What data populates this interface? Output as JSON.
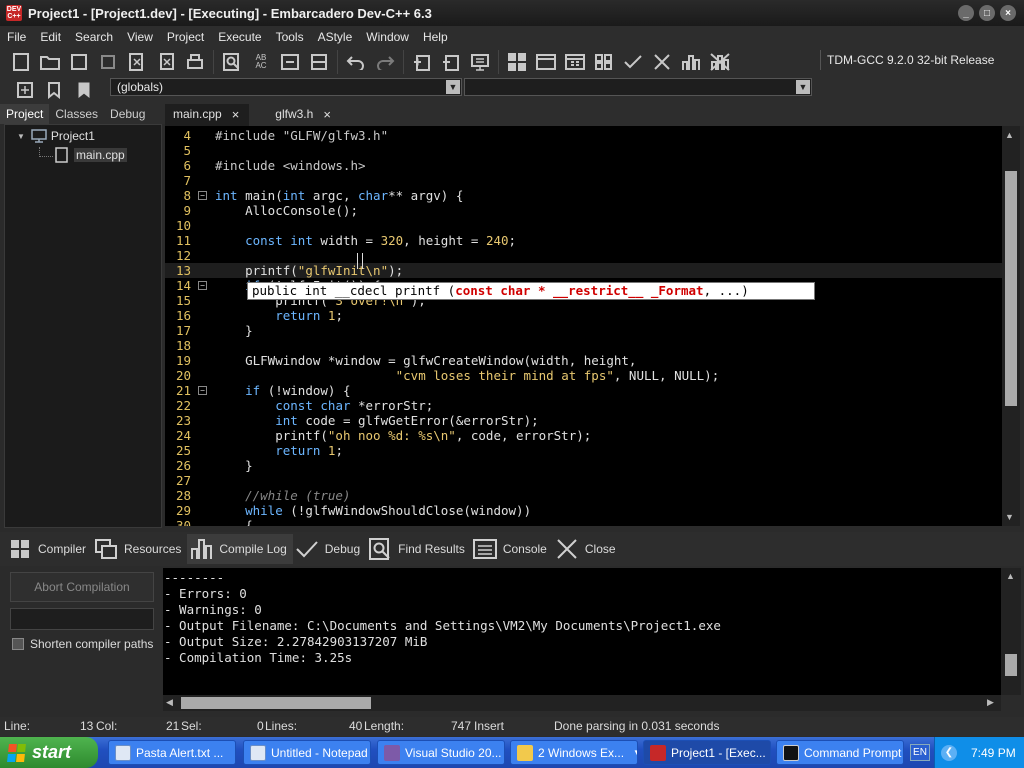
{
  "window": {
    "title": "Project1 - [Project1.dev] - [Executing] - Embarcadero Dev-C++ 6.3",
    "icon_label": "DEV C++",
    "controls": [
      "_",
      "□",
      "×"
    ]
  },
  "menu": [
    "File",
    "Edit",
    "Search",
    "View",
    "Project",
    "Execute",
    "Tools",
    "AStyle",
    "Window",
    "Help"
  ],
  "toolbar": {
    "compiler": "TDM-GCC 9.2.0 32-bit Release",
    "scope_combo": "(globals)",
    "function_combo": ""
  },
  "left_panel": {
    "tabs": [
      "Project",
      "Classes",
      "Debug"
    ],
    "active_tab": "Project",
    "tree": {
      "root": "Project1",
      "children": [
        "main.cpp"
      ]
    }
  },
  "editor": {
    "tabs": [
      {
        "label": "main.cpp",
        "close": "×"
      },
      {
        "label": "glfw3.h",
        "close": "×"
      }
    ],
    "active_tab": "main.cpp",
    "lines": [
      {
        "n": "4",
        "text": "#include \"GLFW/glfw3.h\""
      },
      {
        "n": "5",
        "text": ""
      },
      {
        "n": "6",
        "text": "#include <windows.h>"
      },
      {
        "n": "7",
        "text": ""
      },
      {
        "n": "8",
        "text": "int main(int argc, char** argv) {"
      },
      {
        "n": "9",
        "text": "    AllocConsole();"
      },
      {
        "n": "10",
        "text": ""
      },
      {
        "n": "11",
        "text": "    const int width = 320, height = 240;"
      },
      {
        "n": "12",
        "text": ""
      },
      {
        "n": "13",
        "text": "    printf(\"glfwInit\\n\");"
      },
      {
        "n": "14",
        "text": "    if (!glfwInit()) {"
      },
      {
        "n": "15",
        "text": "        printf(\"3 over!\\n\");"
      },
      {
        "n": "16",
        "text": "        return 1;"
      },
      {
        "n": "17",
        "text": "    }"
      },
      {
        "n": "18",
        "text": ""
      },
      {
        "n": "19",
        "text": "    GLFWwindow *window = glfwCreateWindow(width, height,"
      },
      {
        "n": "20",
        "text": "                        \"cvm loses their mind at fps\", NULL, NULL);"
      },
      {
        "n": "21",
        "text": "    if (!window) {"
      },
      {
        "n": "22",
        "text": "        const char *errorStr;"
      },
      {
        "n": "23",
        "text": "        int code = glfwGetError(&errorStr);"
      },
      {
        "n": "24",
        "text": "        printf(\"oh noo %d: %s\\n\", code, errorStr);"
      },
      {
        "n": "25",
        "text": "        return 1;"
      },
      {
        "n": "26",
        "text": "    }"
      },
      {
        "n": "27",
        "text": ""
      },
      {
        "n": "28",
        "text": "    //while (true)"
      },
      {
        "n": "29",
        "text": "    while (!glfwWindowShouldClose(window))"
      },
      {
        "n": "30",
        "text": "    {"
      }
    ],
    "calltip": {
      "prefix": "public int __cdecl printf (",
      "highlight": "const char * __restrict__ _Format",
      "suffix": ", ...)"
    }
  },
  "bottom": {
    "tabs": [
      "Compiler",
      "Resources",
      "Compile Log",
      "Debug",
      "Find Results",
      "Console",
      "Close"
    ],
    "active_tab": "Compile Log",
    "abort_label": "Abort Compilation",
    "shorten_label": "Shorten compiler paths",
    "log": [
      "--------",
      "- Errors: 0",
      "- Warnings: 0",
      "- Output Filename: C:\\Documents and Settings\\VM2\\My Documents\\Project1.exe",
      "- Output Size: 2.27842903137207 MiB",
      "- Compilation Time: 3.25s"
    ]
  },
  "status": {
    "line_label": "Line:",
    "line": "13",
    "col_label": "Col:",
    "col": "21",
    "sel_label": "Sel:",
    "sel": "0",
    "lines_label": "Lines:",
    "lines": "40",
    "length_label": "Length:",
    "length": "747",
    "mode": "Insert",
    "message": "Done parsing in 0.031 seconds"
  },
  "taskbar": {
    "start": "start",
    "tasks": [
      {
        "label": "Pasta Alert.txt ..."
      },
      {
        "label": "Untitled - Notepad"
      },
      {
        "label": "Visual Studio 20..."
      },
      {
        "label": "2 Windows Ex..."
      },
      {
        "label": "Project1 - [Exec..."
      },
      {
        "label": "Command Prompt"
      }
    ],
    "lang": "EN",
    "clock": "7:49 PM"
  }
}
